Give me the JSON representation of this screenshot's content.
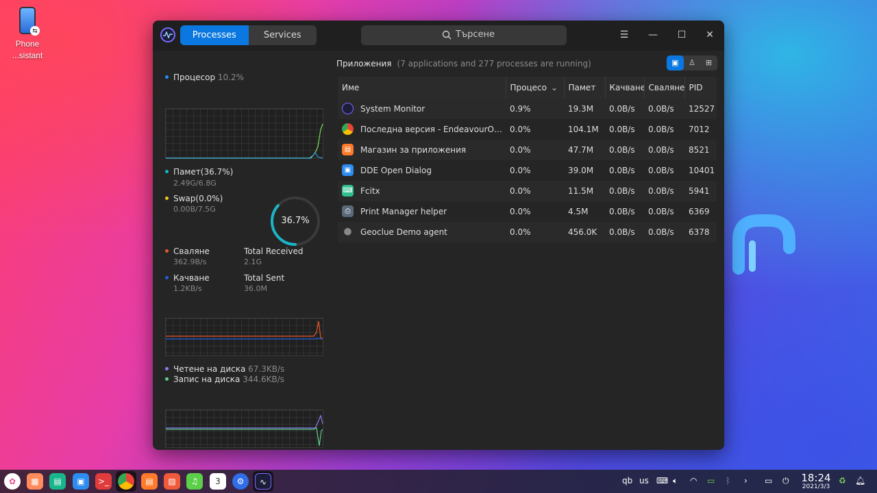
{
  "desktop": {
    "icon": {
      "name": "phone-assistant",
      "label_line1": "Phone",
      "label_line2": "...sistant"
    }
  },
  "window": {
    "tabs": [
      {
        "label": "Processes",
        "active": true
      },
      {
        "label": "Services",
        "active": false
      }
    ],
    "search_placeholder": "Търсене",
    "controls": {
      "menu": "☰",
      "minimize": "—",
      "maximize": "☐",
      "close": "✕"
    }
  },
  "cpu": {
    "label": "Процесор",
    "value": "10.2%",
    "color": "#1e90ff"
  },
  "memory": {
    "label": "Памет(36.7%)",
    "detail": "2.49G/6.8G",
    "color": "#19b6c8",
    "swap_label": "Swap(0.0%)",
    "swap_detail": "0.00B/7.5G",
    "swap_color": "#f0c419",
    "ring_value": "36.7%",
    "ring_fraction": 0.367
  },
  "network": {
    "download_label": "Сваляне",
    "download_value": "362.9B/s",
    "download_color": "#e8572a",
    "total_received_label": "Total Received",
    "total_received_value": "2.1G",
    "upload_label": "Качване",
    "upload_value": "1.2KB/s",
    "upload_color": "#1e5bd8",
    "total_sent_label": "Total Sent",
    "total_sent_value": "36.0M"
  },
  "disk": {
    "read_label": "Четене на диска",
    "read_value": "67.3KB/s",
    "read_color": "#8a7cf0",
    "write_label": "Запис на диска",
    "write_value": "344.6KB/s",
    "write_color": "#5fd08a"
  },
  "apps": {
    "title": "Приложения",
    "count_text": "(7 applications and 277 processes are running)",
    "view_buttons": [
      "app-view-icon",
      "user-view-icon",
      "all-view-icon"
    ],
    "columns": [
      "Име",
      "Процесо",
      "Памет",
      "Качване",
      "Сваляне",
      "PID"
    ],
    "rows": [
      {
        "icon": "system-monitor-icon",
        "name": "System Monitor",
        "cpu": "0.9%",
        "mem": "19.3M",
        "up": "0.0B/s",
        "down": "0.0B/s",
        "pid": "12527"
      },
      {
        "icon": "chrome-icon",
        "name": "Последна версия - EndeavourOS ...",
        "cpu": "0.0%",
        "mem": "104.1M",
        "up": "0.0B/s",
        "down": "0.0B/s",
        "pid": "7012"
      },
      {
        "icon": "app-store-icon",
        "name": "Магазин за приложения",
        "cpu": "0.0%",
        "mem": "47.7M",
        "up": "0.0B/s",
        "down": "0.0B/s",
        "pid": "8521"
      },
      {
        "icon": "dde-dialog-icon",
        "name": "DDE Open Dialog",
        "cpu": "0.0%",
        "mem": "39.0M",
        "up": "0.0B/s",
        "down": "0.0B/s",
        "pid": "10401"
      },
      {
        "icon": "fcitx-icon",
        "name": "Fcitx",
        "cpu": "0.0%",
        "mem": "11.5M",
        "up": "0.0B/s",
        "down": "0.0B/s",
        "pid": "5941"
      },
      {
        "icon": "printer-icon",
        "name": "Print Manager helper",
        "cpu": "0.0%",
        "mem": "4.5M",
        "up": "0.0B/s",
        "down": "0.0B/s",
        "pid": "6369"
      },
      {
        "icon": "location-pin-icon",
        "name": "Geoclue Demo agent",
        "cpu": "0.0%",
        "mem": "456.0K",
        "up": "0.0B/s",
        "down": "0.0B/s",
        "pid": "6378"
      }
    ]
  },
  "taskbar": {
    "apps": [
      "launcher-icon",
      "multitasking-icon",
      "file-manager-icon",
      "app-store-icon",
      "terminal-icon",
      "chrome-icon",
      "deepin-store-icon",
      "image-viewer-icon",
      "music-icon",
      "calendar-icon",
      "settings-icon",
      "system-monitor-icon"
    ],
    "calendar_day": "3",
    "tray": {
      "kbd1": "qb",
      "kbd2": "us"
    },
    "time": "18:24",
    "date": "2021/3/3"
  }
}
